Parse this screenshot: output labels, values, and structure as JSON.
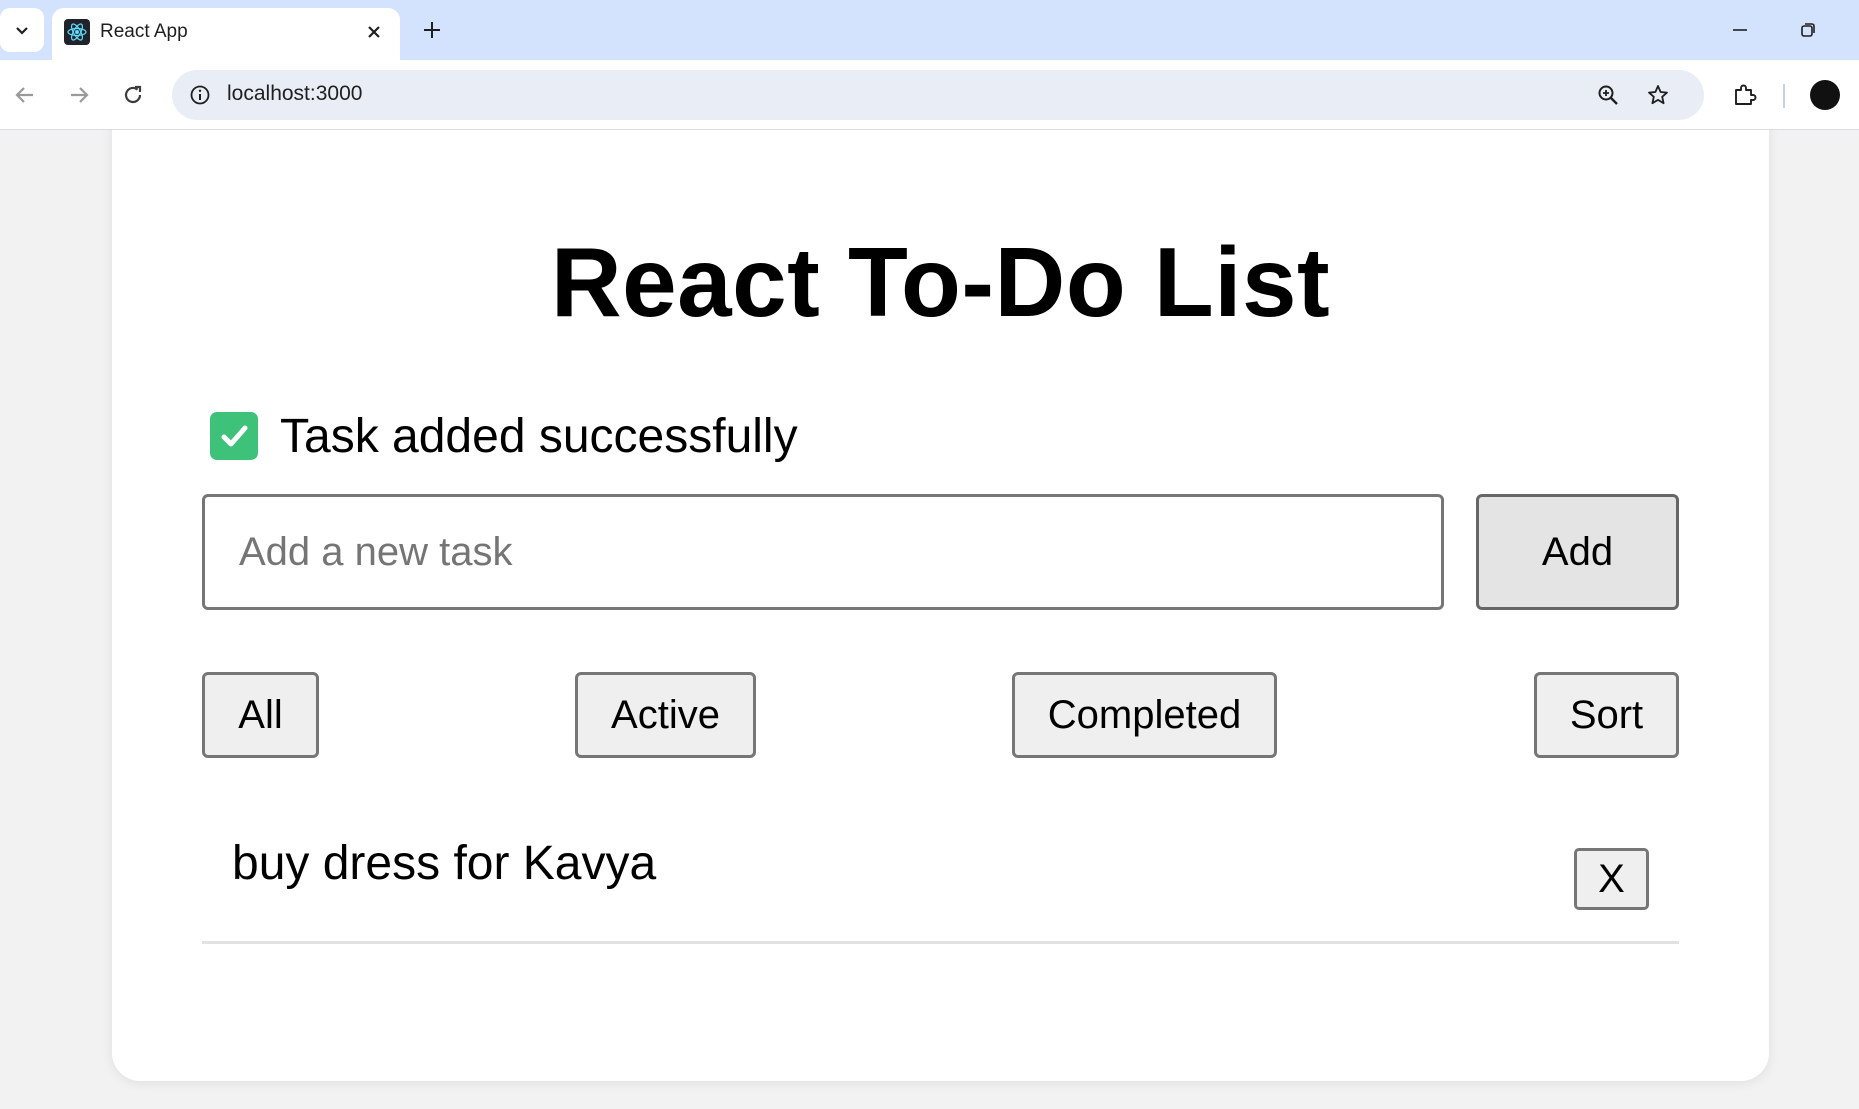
{
  "browser": {
    "tab_title": "React App",
    "url": "localhost:3000",
    "icons": [
      "tab-search-icon",
      "react-favicon-icon",
      "close-icon",
      "plus-icon",
      "minimize-icon",
      "restore-icon",
      "back-icon",
      "forward-icon",
      "reload-icon",
      "site-info-icon",
      "zoom-icon",
      "star-icon",
      "extensions-icon",
      "profile-avatar"
    ]
  },
  "app": {
    "title": "React To-Do List",
    "notice": {
      "text": "Task added successfully",
      "icon": "check-mark-icon",
      "color": "#3ec27a"
    },
    "input": {
      "placeholder": "Add a new task",
      "value": ""
    },
    "add_label": "Add",
    "filters": {
      "all": "All",
      "active": "Active",
      "completed": "Completed",
      "sort": "Sort"
    },
    "tasks": [
      {
        "text": "buy dress for Kavya",
        "delete_label": "X"
      }
    ]
  }
}
